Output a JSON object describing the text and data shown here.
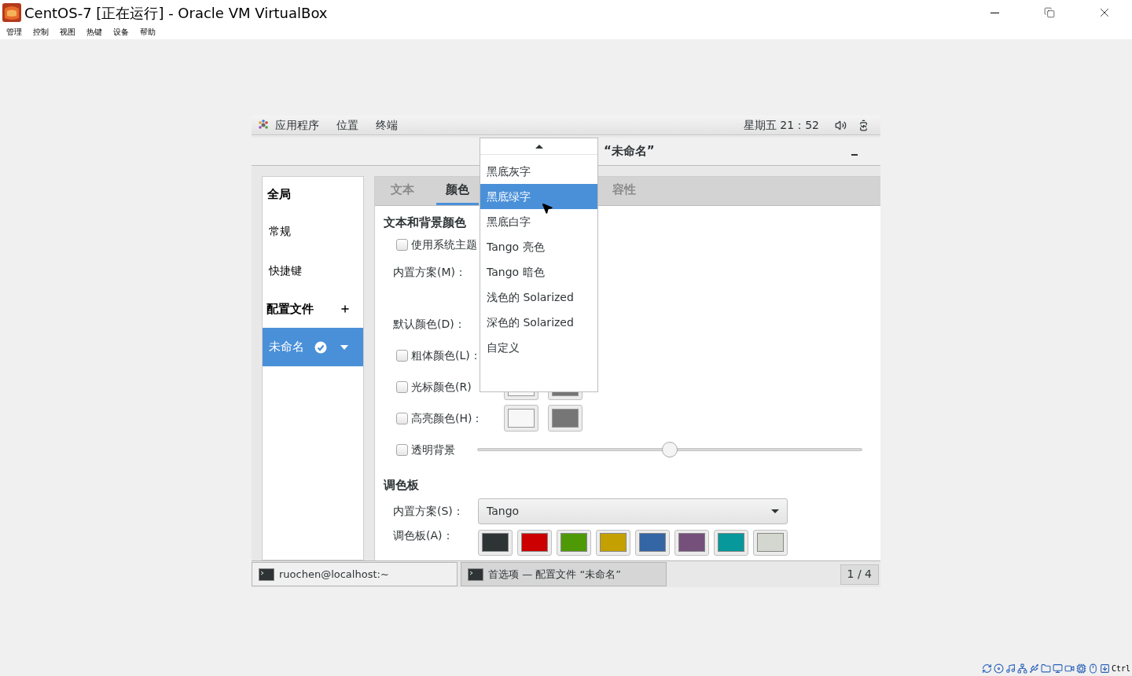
{
  "window": {
    "title": "CentOS-7 [正在运行] - Oracle VM VirtualBox",
    "menu": [
      "管理",
      "控制",
      "视图",
      "热键",
      "设备",
      "帮助"
    ]
  },
  "top_bar": {
    "menus": [
      "应用程序",
      "位置",
      "终端"
    ],
    "clock": "星期五 21：52"
  },
  "dialog": {
    "title": "“未命名”",
    "sidebar": [
      {
        "label": "全局",
        "kind": "heading"
      },
      {
        "label": "常规",
        "kind": "item",
        "selected": false
      },
      {
        "label": "快捷键",
        "kind": "item",
        "selected": false
      },
      {
        "label": "配置文件",
        "kind": "section"
      },
      {
        "label": "未命名",
        "kind": "profile",
        "selected": true
      }
    ],
    "tabs": [
      {
        "label": "文本",
        "selected": false
      },
      {
        "label": "颜色",
        "selected": true
      },
      {
        "label": "容性",
        "selected": false
      }
    ],
    "section_title": "文本和背景颜色",
    "use_system_theme": {
      "label": "使用系统主题",
      "checked": false
    },
    "builtin_scheme_label": "内置方案(M)：",
    "default_color_label": "默认颜色(D)：",
    "color_rows": [
      {
        "label": "粗体颜色(L)：",
        "checked": false,
        "kind": "plain"
      },
      {
        "label": "光标颜色(R)",
        "checked": false,
        "kind": "swatches"
      },
      {
        "label": "高亮颜色(H)：",
        "checked": false,
        "kind": "swatches"
      }
    ],
    "transparent": {
      "label": "透明背景",
      "checked": false,
      "level": 0.5
    },
    "palette": {
      "title": "调色板",
      "scheme_label": "内置方案(S)：",
      "scheme_value": "Tango",
      "palette_label": "调色板(A)：",
      "swatches": [
        {
          "color": "#2e3436"
        },
        {
          "color": "#cc0000"
        },
        {
          "color": "#4e9a06"
        },
        {
          "color": "#c4a000"
        },
        {
          "color": "#3465a4"
        },
        {
          "color": "#75507b"
        },
        {
          "color": "#06989a"
        },
        {
          "color": "#d3d7cf"
        }
      ]
    },
    "dropdown": [
      {
        "label": "黑底灰字",
        "selected": false
      },
      {
        "label": "黑底绿字",
        "selected": true
      },
      {
        "label": "黑底白字",
        "selected": false
      },
      {
        "label": "Tango 亮色",
        "selected": false
      },
      {
        "label": "Tango 暗色",
        "selected": false
      },
      {
        "label": "浅色的 Solarized",
        "selected": false
      },
      {
        "label": "深色的 Solarized",
        "selected": false
      },
      {
        "label": "自定义",
        "selected": false
      }
    ]
  },
  "taskbar": {
    "items": [
      {
        "label": "ruochen@localhost:~",
        "selected": false
      },
      {
        "label": "首选项 — 配置文件 “未命名”",
        "selected": true
      }
    ],
    "workspace": "1 / 4"
  },
  "status_bar": {
    "host_key": "Ctrl"
  }
}
